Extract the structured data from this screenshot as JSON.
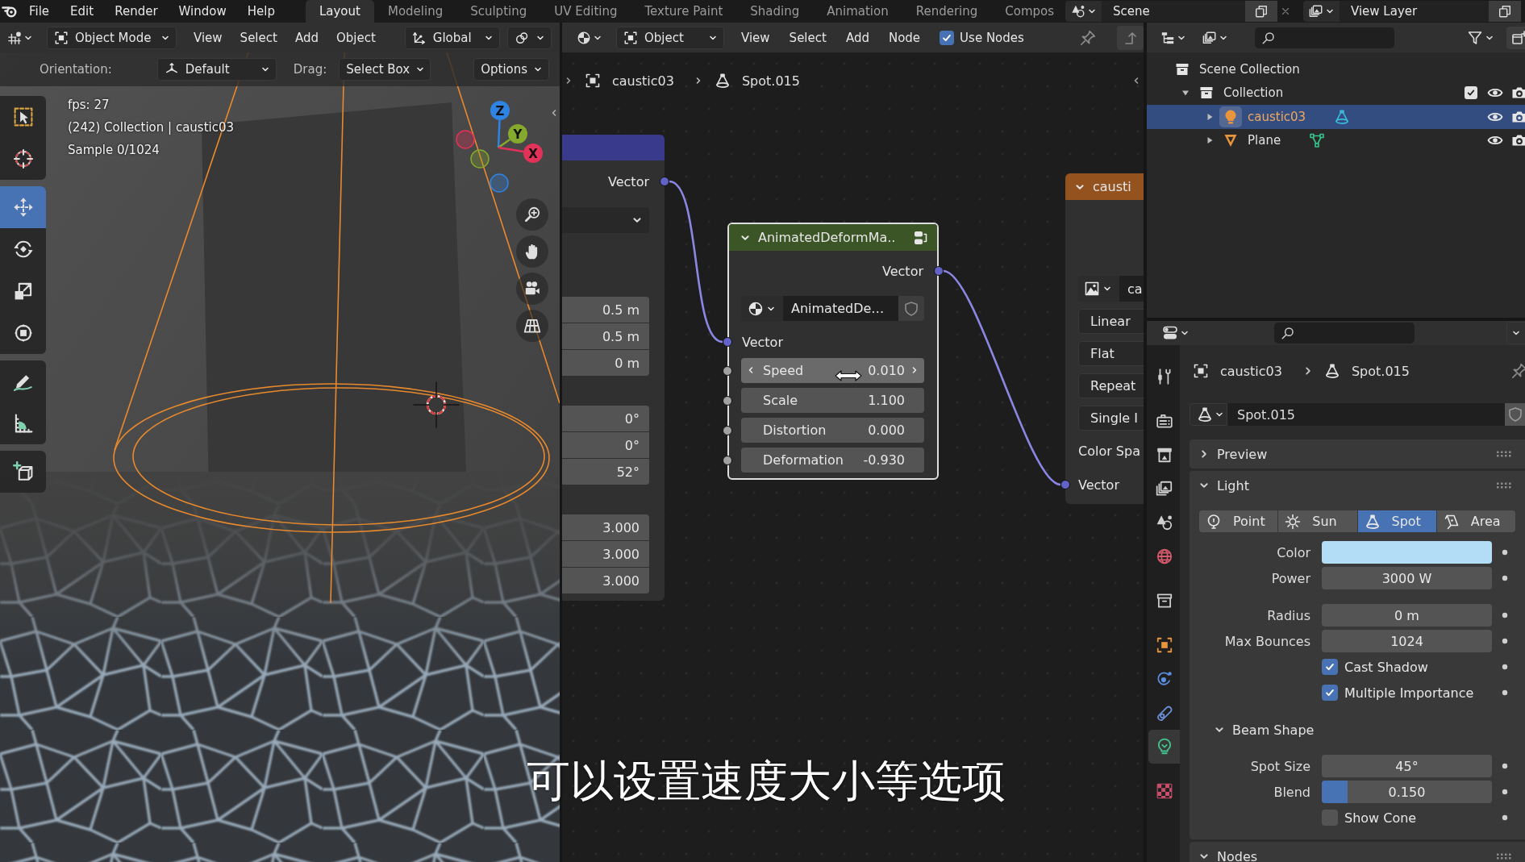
{
  "menu_bar": {
    "menus": [
      "File",
      "Edit",
      "Render",
      "Window",
      "Help"
    ],
    "workspaces": [
      {
        "label": "Layout",
        "selected": true
      },
      {
        "label": "Modeling",
        "selected": false
      },
      {
        "label": "Sculpting",
        "selected": false
      },
      {
        "label": "UV Editing",
        "selected": false
      },
      {
        "label": "Texture Paint",
        "selected": false
      },
      {
        "label": "Shading",
        "selected": false
      },
      {
        "label": "Animation",
        "selected": false
      },
      {
        "label": "Rendering",
        "selected": false
      },
      {
        "label": "Compos",
        "selected": false
      }
    ],
    "scene": "Scene",
    "view_layer": "View Layer"
  },
  "viewport": {
    "header": {
      "mode": "Object Mode",
      "menus": [
        "View",
        "Select",
        "Add",
        "Object"
      ],
      "transform_orientation": "Global"
    },
    "tool_settings": {
      "orientation_label": "Orientation:",
      "orientation": "Default",
      "drag_label": "Drag:",
      "drag": "Select Box",
      "options": "Options"
    },
    "tool_groups": [
      {
        "tools": [
          {
            "kind": "select_box",
            "selected": false
          },
          {
            "kind": "cursor",
            "selected": false
          }
        ]
      },
      {
        "tools": [
          {
            "kind": "move",
            "selected": true
          },
          {
            "kind": "rotate",
            "selected": false
          },
          {
            "kind": "scale",
            "selected": false
          },
          {
            "kind": "transform",
            "selected": false
          }
        ]
      },
      {
        "tools": [
          {
            "kind": "annotate",
            "selected": false
          },
          {
            "kind": "measure",
            "selected": false
          }
        ]
      },
      {
        "tools": [
          {
            "kind": "add_cube",
            "selected": false
          }
        ]
      }
    ],
    "info_lines": [
      "fps: 27",
      "(242) Collection | caustic03",
      "Sample 0/1024"
    ],
    "gizmo_axes": [
      {
        "label": "Z",
        "color": "#2f83e3"
      },
      {
        "label": "Y",
        "color": "#84a92d"
      },
      {
        "label": "X",
        "color": "#e2325a"
      }
    ]
  },
  "node_editor": {
    "header": {
      "object": "Object",
      "menus": [
        "View",
        "Select",
        "Add",
        "Node"
      ],
      "use_nodes": {
        "label": "Use Nodes",
        "checked": true
      }
    },
    "breadcrumb": [
      "caustic03",
      "Spot.015"
    ],
    "nodes": [
      {
        "kind": "mapping",
        "color": "#3a3a8c",
        "outputs": [
          {
            "label": "Vector",
            "linked": true
          }
        ],
        "value_groups": [
          {
            "values": [
              "0.5 m",
              "0.5 m",
              "0 m"
            ]
          },
          {
            "values": [
              "0°",
              "0°",
              "52°"
            ]
          },
          {
            "values": [
              "3.000",
              "3.000",
              "3.000"
            ]
          }
        ]
      },
      {
        "kind": "group",
        "color": "#3c5526",
        "title": "AnimatedDeformMa..",
        "outputs": [
          {
            "label": "Vector",
            "linked": true
          }
        ],
        "datablock": "AnimatedDe…",
        "inputs": [
          {
            "kind": "vector",
            "label": "Vector",
            "linked": true
          },
          {
            "kind": "value",
            "label": "Speed",
            "value": "0.010",
            "hovered": true
          },
          {
            "kind": "value",
            "label": "Scale",
            "value": "1.100",
            "hovered": false
          },
          {
            "kind": "value",
            "label": "Distortion",
            "value": "0.000",
            "hovered": false
          },
          {
            "kind": "value",
            "label": "Deformation",
            "value": "-0.930",
            "hovered": false
          }
        ]
      },
      {
        "kind": "image_texture",
        "color": "#94521f",
        "title": "causti",
        "image": "ca",
        "options": [
          "Linear",
          "Flat",
          "Repeat",
          "Single I"
        ],
        "color_space_label": "Color Spa",
        "inputs": [
          {
            "kind": "vector",
            "label": "Vector",
            "linked": true
          }
        ]
      }
    ]
  },
  "outliner": {
    "tree": [
      {
        "kind": "scene_collection",
        "label": "Scene Collection",
        "selected": false,
        "children": [
          {
            "kind": "collection",
            "label": "Collection",
            "expanded": true,
            "selected": false,
            "checked": true,
            "children": [
              {
                "kind": "light",
                "label": "caustic03",
                "expanded": false,
                "selected": true
              },
              {
                "kind": "mesh",
                "label": "Plane",
                "expanded": false,
                "selected": false
              }
            ]
          }
        ]
      }
    ]
  },
  "properties": {
    "tab_groups": [
      {
        "tabs": [
          {
            "kind": "tool",
            "selected": false
          }
        ]
      },
      {
        "tabs": [
          {
            "kind": "render",
            "selected": false
          },
          {
            "kind": "output",
            "selected": false
          },
          {
            "kind": "view_layer",
            "selected": false
          },
          {
            "kind": "scene",
            "selected": false
          },
          {
            "kind": "world",
            "selected": false
          }
        ]
      },
      {
        "tabs": [
          {
            "kind": "collection",
            "selected": false
          }
        ]
      },
      {
        "tabs": [
          {
            "kind": "object",
            "selected": false
          },
          {
            "kind": "physics",
            "selected": false
          },
          {
            "kind": "constraints",
            "selected": false
          },
          {
            "kind": "light_data",
            "selected": true
          }
        ]
      },
      {
        "tabs": [
          {
            "kind": "texture",
            "selected": false
          }
        ]
      }
    ],
    "breadcrumb": [
      "caustic03",
      "Spot.015"
    ],
    "datablock": "Spot.015",
    "panels": [
      {
        "title": "Preview",
        "expanded": false
      },
      {
        "title": "Light",
        "expanded": true,
        "light_types": [
          {
            "kind": "point",
            "label": "Point",
            "selected": false
          },
          {
            "kind": "sun",
            "label": "Sun",
            "selected": false
          },
          {
            "kind": "spot",
            "label": "Spot",
            "selected": true
          },
          {
            "kind": "area",
            "label": "Area",
            "selected": false
          }
        ],
        "row_groups": [
          {
            "rows": [
              {
                "kind": "color",
                "label": "Color",
                "color": "#b3ddf7"
              },
              {
                "kind": "number",
                "label": "Power",
                "value": "3000 W"
              }
            ]
          },
          {
            "rows": [
              {
                "kind": "number",
                "label": "Radius",
                "value": "0 m"
              },
              {
                "kind": "number",
                "label": "Max Bounces",
                "value": "1024"
              },
              {
                "kind": "checkbox",
                "label": "Cast Shadow",
                "checked": true
              },
              {
                "kind": "checkbox",
                "label": "Multiple Importance",
                "checked": true
              }
            ]
          }
        ],
        "subpanels": [
          {
            "title": "Beam Shape",
            "expanded": true,
            "rows": [
              {
                "kind": "number",
                "label": "Spot Size",
                "value": "45°"
              },
              {
                "kind": "slider",
                "label": "Blend",
                "value": "0.150",
                "level": 0.15
              },
              {
                "kind": "checkbox",
                "label": "Show Cone",
                "checked": false
              }
            ]
          }
        ]
      },
      {
        "title": "Nodes",
        "expanded": true
      }
    ]
  },
  "subtitle": "可以设置速度大小等选项"
}
